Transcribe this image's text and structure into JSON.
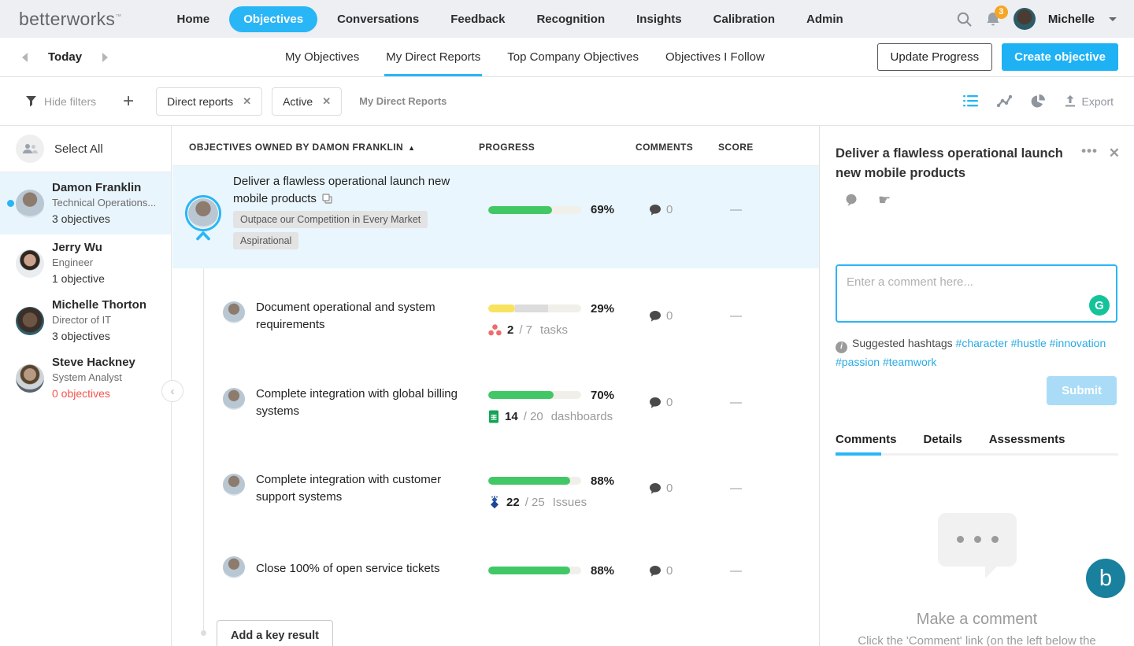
{
  "brand": {
    "logo_text": "betterworks",
    "accent": "#29b6f6"
  },
  "nav": {
    "items": [
      "Home",
      "Objectives",
      "Conversations",
      "Feedback",
      "Recognition",
      "Insights",
      "Calibration",
      "Admin"
    ],
    "active_item": "Objectives",
    "notification_count": "3",
    "user_name": "Michelle"
  },
  "subheader": {
    "date_label": "Today",
    "tabs": [
      "My Objectives",
      "My Direct Reports",
      "Top Company Objectives",
      "Objectives I Follow"
    ],
    "active_tab": "My Direct Reports",
    "buttons": {
      "update_progress": "Update Progress",
      "create_objective": "Create objective"
    }
  },
  "filter_bar": {
    "hide_filters_label": "Hide filters",
    "chips": [
      {
        "label": "Direct reports"
      },
      {
        "label": "Active"
      }
    ],
    "context_label": "My Direct Reports",
    "export_label": "Export"
  },
  "sidebar": {
    "select_all_label": "Select All",
    "people": [
      {
        "name": "Damon Franklin",
        "role": "Technical Operations...",
        "objectives": "3 objectives",
        "selected": true
      },
      {
        "name": "Jerry Wu",
        "role": "Engineer",
        "objectives": "1 objective"
      },
      {
        "name": "Michelle Thorton",
        "role": "Director of IT",
        "objectives": "3 objectives"
      },
      {
        "name": "Steve Hackney",
        "role": "System Analyst",
        "objectives": "0 objectives",
        "objectives_color": "#f4554a"
      }
    ]
  },
  "table": {
    "columns": {
      "objectives": "OBJECTIVES OWNED BY DAMON FRANKLIN",
      "progress": "PROGRESS",
      "comments": "COMMENTS",
      "score": "SCORE"
    },
    "rows": [
      {
        "title": "Deliver a flawless operational launch new mobile products",
        "tags": [
          "Outpace our Competition in Every Market",
          "Aspirational"
        ],
        "progress_pct": "69%",
        "bar_color": "#42c767",
        "comments": "0",
        "score": "—"
      },
      {
        "title": "Document operational and system requirements",
        "progress_pct": "29%",
        "expected_extra_pct": "35%",
        "bar_color": "#f7e35f",
        "integration": {
          "icon": "asana",
          "done": "2",
          "rest": "/ 7",
          "unit": "tasks"
        },
        "comments": "0",
        "score": "—"
      },
      {
        "title": "Complete integration with global billing systems",
        "progress_pct": "70%",
        "bar_color": "#42c767",
        "integration": {
          "icon": "google-sheets",
          "done": "14",
          "rest": "/ 20",
          "unit": "dashboards"
        },
        "comments": "0",
        "score": "—"
      },
      {
        "title": "Complete integration with customer support systems",
        "progress_pct": "88%",
        "bar_color": "#42c767",
        "integration": {
          "icon": "jira",
          "done": "22",
          "rest": "/ 25",
          "unit": "Issues"
        },
        "comments": "0",
        "score": "—"
      },
      {
        "title": "Close 100% of open service tickets",
        "progress_pct": "88%",
        "bar_color": "#42c767",
        "comments": "0",
        "score": "—"
      }
    ],
    "add_key_result_label": "Add a key result"
  },
  "detail_panel": {
    "title": "Deliver a flawless operational launch new mobile products",
    "comment_placeholder": "Enter a comment here...",
    "grammarly_label": "G",
    "hashtags_label": "Suggested hashtags",
    "hashtags": [
      "#character",
      "#hustle",
      "#innovation",
      "#passion",
      "#teamwork"
    ],
    "submit_label": "Submit",
    "tabs": [
      "Comments",
      "Details",
      "Assessments"
    ],
    "active_tab": "Comments",
    "chat_fab_label": "b",
    "empty_state": {
      "title": "Make a comment",
      "caption": "Click the 'Comment' link (on the left below the"
    }
  }
}
